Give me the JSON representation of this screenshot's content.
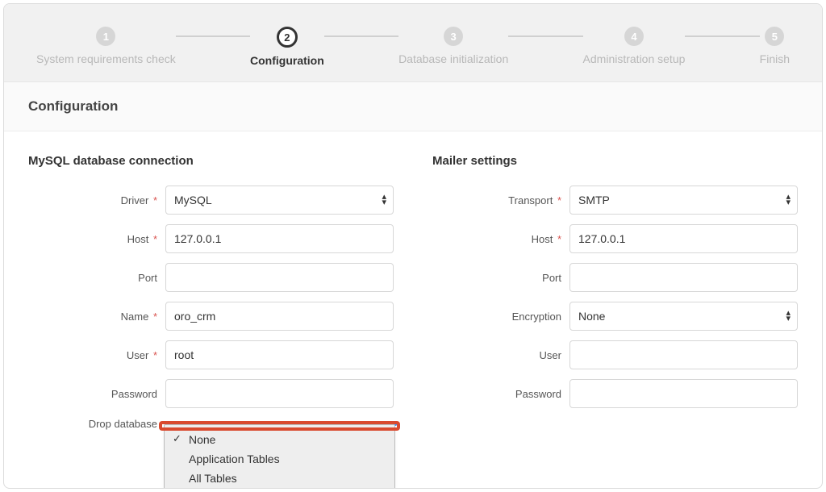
{
  "wizard": {
    "steps": [
      {
        "num": "1",
        "label": "System requirements check"
      },
      {
        "num": "2",
        "label": "Configuration"
      },
      {
        "num": "3",
        "label": "Database initialization"
      },
      {
        "num": "4",
        "label": "Administration setup"
      },
      {
        "num": "5",
        "label": "Finish"
      }
    ],
    "active_index": 1
  },
  "page": {
    "title": "Configuration"
  },
  "db": {
    "heading": "MySQL database connection",
    "driver_label": "Driver",
    "driver_value": "MySQL",
    "host_label": "Host",
    "host_value": "127.0.0.1",
    "port_label": "Port",
    "port_value": "",
    "name_label": "Name",
    "name_value": "oro_crm",
    "user_label": "User",
    "user_value": "root",
    "password_label": "Password",
    "password_value": "",
    "drop_label": "Drop database",
    "drop_options": [
      "None",
      "Application Tables",
      "All Tables"
    ],
    "drop_selected": "None"
  },
  "mailer": {
    "heading": "Mailer settings",
    "transport_label": "Transport",
    "transport_value": "SMTP",
    "host_label": "Host",
    "host_value": "127.0.0.1",
    "port_label": "Port",
    "port_value": "",
    "encryption_label": "Encryption",
    "encryption_value": "None",
    "user_label": "User",
    "user_value": "",
    "password_label": "Password",
    "password_value": ""
  }
}
